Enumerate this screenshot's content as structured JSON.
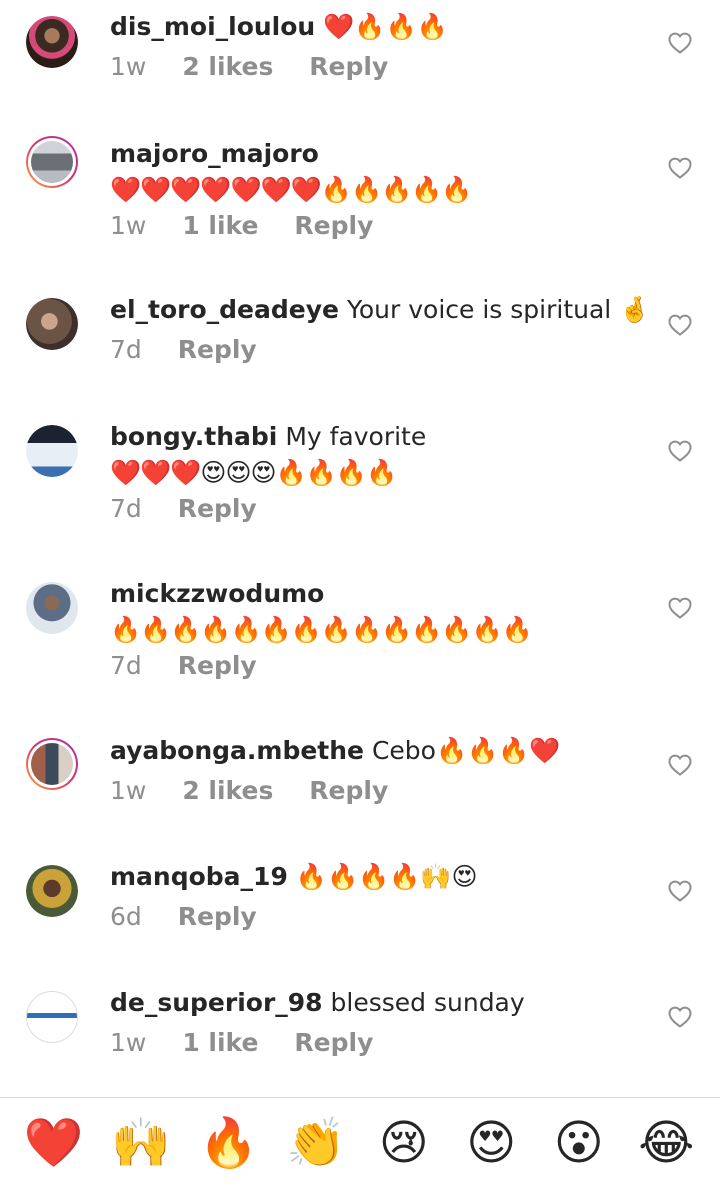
{
  "comments": [
    {
      "username": "dis_moi_loulou",
      "text": "",
      "emoji_inline": "❤️🔥🔥🔥",
      "emoji_line": "",
      "time": "1w",
      "likes": "2 likes",
      "reply": "Reply",
      "avatar_color": "#3b2a22"
    },
    {
      "username": "majoro_majoro",
      "text": "",
      "emoji_inline": "",
      "emoji_line": "❤️❤️❤️❤️❤️❤️❤️🔥🔥🔥🔥🔥",
      "time": "1w",
      "likes": "1 like",
      "reply": "Reply",
      "avatar_color": "#9aa0a8"
    },
    {
      "username": "el_toro_deadeye",
      "text": "Your voice is spiritual",
      "emoji_inline": "🤞",
      "emoji_line": "",
      "time": "7d",
      "likes": "",
      "reply": "Reply",
      "avatar_color": "#6b5446"
    },
    {
      "username": "bongy.thabi",
      "text": "My favorite",
      "emoji_inline": "",
      "emoji_line": "❤️❤️❤️😍😍😍🔥🔥🔥🔥",
      "time": "7d",
      "likes": "",
      "reply": "Reply",
      "avatar_color": "#2b3340"
    },
    {
      "username": "mickzzwodumo",
      "text": "",
      "emoji_inline": "",
      "emoji_line": "🔥🔥🔥🔥🔥🔥🔥🔥🔥🔥🔥🔥🔥🔥",
      "time": "7d",
      "likes": "",
      "reply": "Reply",
      "avatar_color": "#5c6d86"
    },
    {
      "username": "ayabonga.mbethe",
      "text": "Cebo",
      "emoji_inline": "🔥🔥🔥❤️",
      "emoji_line": "",
      "time": "1w",
      "likes": "2 likes",
      "reply": "Reply",
      "avatar_color": "#7a5a4c"
    },
    {
      "username": "manqoba_19",
      "text": "",
      "emoji_inline": "🔥🔥🔥🔥🙌😍",
      "emoji_line": "",
      "time": "6d",
      "likes": "",
      "reply": "Reply",
      "avatar_color": "#c9a23a"
    },
    {
      "username": "de_superior_98",
      "text": "blessed sunday",
      "emoji_inline": "",
      "emoji_line": "",
      "time": "1w",
      "likes": "1 like",
      "reply": "Reply",
      "avatar_color": "#f4f4f4"
    }
  ],
  "quick_reactions": [
    "❤️",
    "🙌",
    "🔥",
    "👏",
    "😢",
    "😍",
    "😮",
    "😂"
  ],
  "colors": {
    "meta_gray": "#8e8e8e",
    "text_dark": "#262626",
    "divider": "#dbdbdb"
  },
  "icons": {
    "like": "heart-outline-icon"
  }
}
